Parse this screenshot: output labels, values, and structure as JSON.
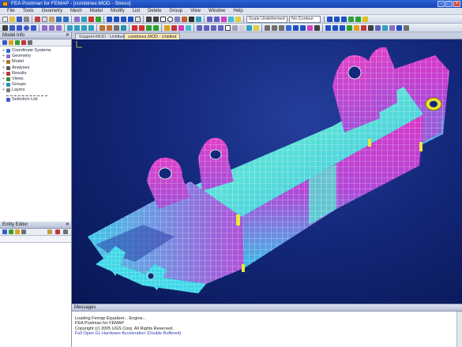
{
  "window": {
    "title": "FEA Postman for FEMAP - [combinex.MOD - Stress]"
  },
  "menu": [
    "File",
    "Tools",
    "Geometry",
    "Mesh",
    "Model",
    "Modify",
    "List",
    "Delete",
    "Group",
    "View",
    "Window",
    "Help"
  ],
  "toolbar": {
    "view_combo": "Scale Undeformed",
    "mode_combo": "No Contour"
  },
  "model_info": {
    "title": "Model Info",
    "tree": [
      {
        "label": "Coordinate Systems",
        "color": "#2d6bd0"
      },
      {
        "label": "Geometry",
        "color": "#8d6fc8"
      },
      {
        "label": "Model",
        "color": "#b0742b"
      },
      {
        "label": "Analyses",
        "color": "#5a5a5a"
      },
      {
        "label": "Results",
        "color": "#c03838"
      },
      {
        "label": "Views",
        "color": "#3a8a3a"
      },
      {
        "label": "Groups",
        "color": "#2b8fb0"
      },
      {
        "label": "Layers",
        "color": "#7a7a7a"
      }
    ],
    "selection_list": "Selection List"
  },
  "data_table": {
    "title": "Entity Editor"
  },
  "tabs": {
    "tab1": "Support-MOD - Untitled",
    "tab2": "combinex.MOD - Untitled"
  },
  "messages": {
    "title": "Messages",
    "lines": [
      "Loading Femap Equalizer... Engine...",
      "FEA Postman for FEMAP",
      "Copyright (c) 2005 UGS Corp. All Rights Reserved.",
      "Full Open GL Hardware Acceleration (Double Buffered)"
    ]
  },
  "colors": {
    "viewport_bg": "#14287a",
    "mesh_cyan": "#3fd8e8",
    "mesh_magenta": "#d838c8",
    "mesh_yellow": "#e8e838"
  }
}
